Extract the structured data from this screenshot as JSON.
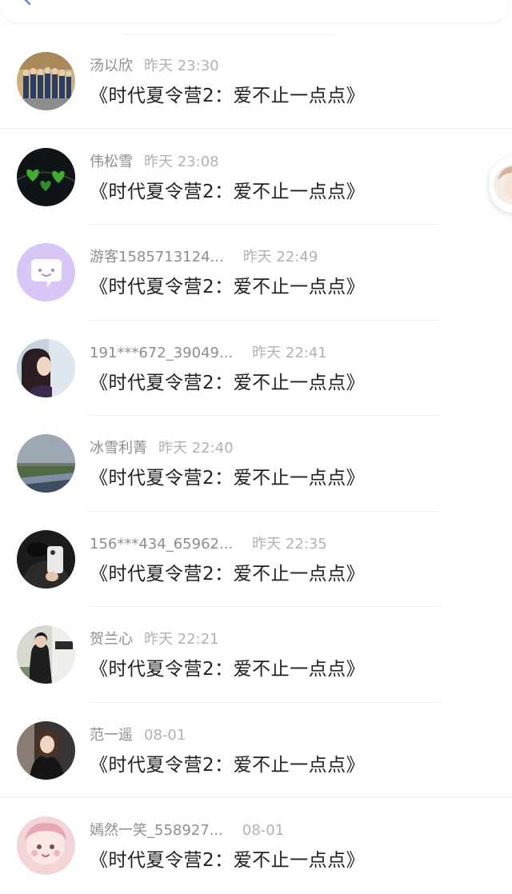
{
  "messages": [
    {
      "name": "汤以欣",
      "time": "昨天 23:30",
      "title": "《时代夏令营2：爱不止一点点》",
      "avatar": "group-photo-avatar"
    },
    {
      "name": "伟松雪",
      "time": "昨天 23:08",
      "title": "《时代夏令营2：爱不止一点点》",
      "avatar": "green-hearts-avatar"
    },
    {
      "name": "游客1585713124...",
      "time": "昨天 22:49",
      "title": "《时代夏令营2：爱不止一点点》",
      "avatar": "purple-chat-bubble-avatar"
    },
    {
      "name": "191***672_39049...",
      "time": "昨天 22:41",
      "title": "《时代夏令营2：爱不止一点点》",
      "avatar": "girl-portrait-avatar"
    },
    {
      "name": "冰雪利菁",
      "time": "昨天 22:40",
      "title": "《时代夏令营2：爱不止一点点》",
      "avatar": "landscape-avatar"
    },
    {
      "name": "156***434_65962...",
      "time": "昨天 22:35",
      "title": "《时代夏令营2：爱不止一点点》",
      "avatar": "selfie-avatar"
    },
    {
      "name": "贺兰心",
      "time": "昨天 22:21",
      "title": "《时代夏令营2：爱不止一点点》",
      "avatar": "street-photo-avatar"
    },
    {
      "name": "范一遥",
      "time": "08-01",
      "title": "《时代夏令营2：爱不止一点点》",
      "avatar": "woman-dark-avatar"
    },
    {
      "name": "嫣然一笑_558927...",
      "time": "08-01",
      "title": "《时代夏令营2：爱不止一点点》",
      "avatar": "pink-cartoon-avatar"
    }
  ],
  "colors": {
    "name": "#8e8e8e",
    "time": "#b2b2b2",
    "title": "#222222",
    "accent": "#4a90e2",
    "chat_bubble_bg": "#d8c6f7"
  }
}
